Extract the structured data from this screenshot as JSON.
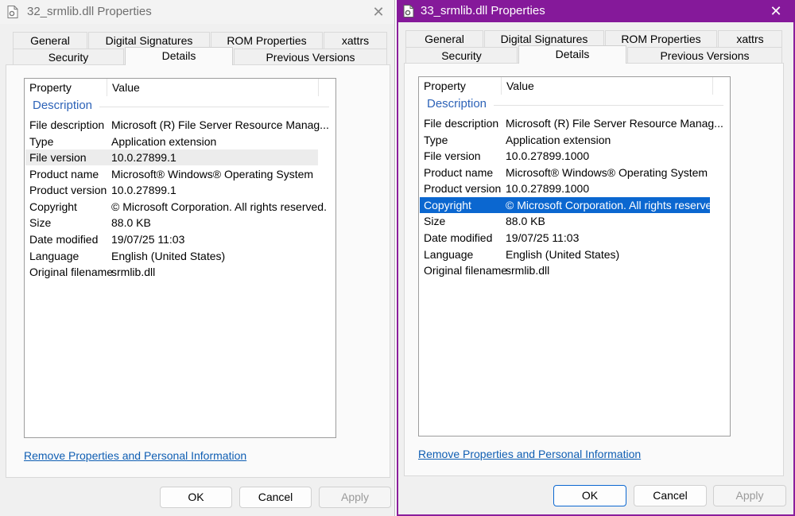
{
  "windows": [
    {
      "title": "32_srmlib.dll Properties",
      "tabs_row1": [
        "General",
        "Digital Signatures",
        "ROM Properties",
        "xattrs"
      ],
      "tabs_row2": [
        "Security",
        "Details",
        "Previous Versions"
      ],
      "active_tab": "Details",
      "columns": [
        "Property",
        "Value"
      ],
      "group": "Description",
      "rows": [
        {
          "prop": "File description",
          "val": "Microsoft (R) File Server Resource Manag..."
        },
        {
          "prop": "Type",
          "val": "Application extension"
        },
        {
          "prop": "File version",
          "val": "10.0.27899.1"
        },
        {
          "prop": "Product name",
          "val": "Microsoft® Windows® Operating System"
        },
        {
          "prop": "Product version",
          "val": "10.0.27899.1"
        },
        {
          "prop": "Copyright",
          "val": "© Microsoft Corporation. All rights reserved."
        },
        {
          "prop": "Size",
          "val": "88.0 KB"
        },
        {
          "prop": "Date modified",
          "val": "19/07/25 11:03"
        },
        {
          "prop": "Language",
          "val": "English (United States)"
        },
        {
          "prop": "Original filename",
          "val": "srmlib.dll"
        }
      ],
      "link": "Remove Properties and Personal Information",
      "buttons": {
        "ok": "OK",
        "cancel": "Cancel",
        "apply": "Apply"
      }
    },
    {
      "title": "33_srmlib.dll Properties",
      "tabs_row1": [
        "General",
        "Digital Signatures",
        "ROM Properties",
        "xattrs"
      ],
      "tabs_row2": [
        "Security",
        "Details",
        "Previous Versions"
      ],
      "active_tab": "Details",
      "columns": [
        "Property",
        "Value"
      ],
      "group": "Description",
      "rows": [
        {
          "prop": "File description",
          "val": "Microsoft (R) File Server Resource Manag..."
        },
        {
          "prop": "Type",
          "val": "Application extension"
        },
        {
          "prop": "File version",
          "val": "10.0.27899.1000"
        },
        {
          "prop": "Product name",
          "val": "Microsoft® Windows® Operating System"
        },
        {
          "prop": "Product version",
          "val": "10.0.27899.1000"
        },
        {
          "prop": "Copyright",
          "val": "© Microsoft Corporation. All rights reserved."
        },
        {
          "prop": "Size",
          "val": "88.0 KB"
        },
        {
          "prop": "Date modified",
          "val": "19/07/25 11:03"
        },
        {
          "prop": "Language",
          "val": "English (United States)"
        },
        {
          "prop": "Original filename",
          "val": "srmlib.dll"
        }
      ],
      "link": "Remove Properties and Personal Information",
      "buttons": {
        "ok": "OK",
        "cancel": "Cancel",
        "apply": "Apply"
      }
    }
  ],
  "icons": {
    "title": "document-gear-icon",
    "close": "close-icon"
  },
  "colors": {
    "active_titlebar": "#85199a",
    "selection": "#0b67d0",
    "link": "#0f5eb3",
    "group_title": "#2d63b8"
  }
}
